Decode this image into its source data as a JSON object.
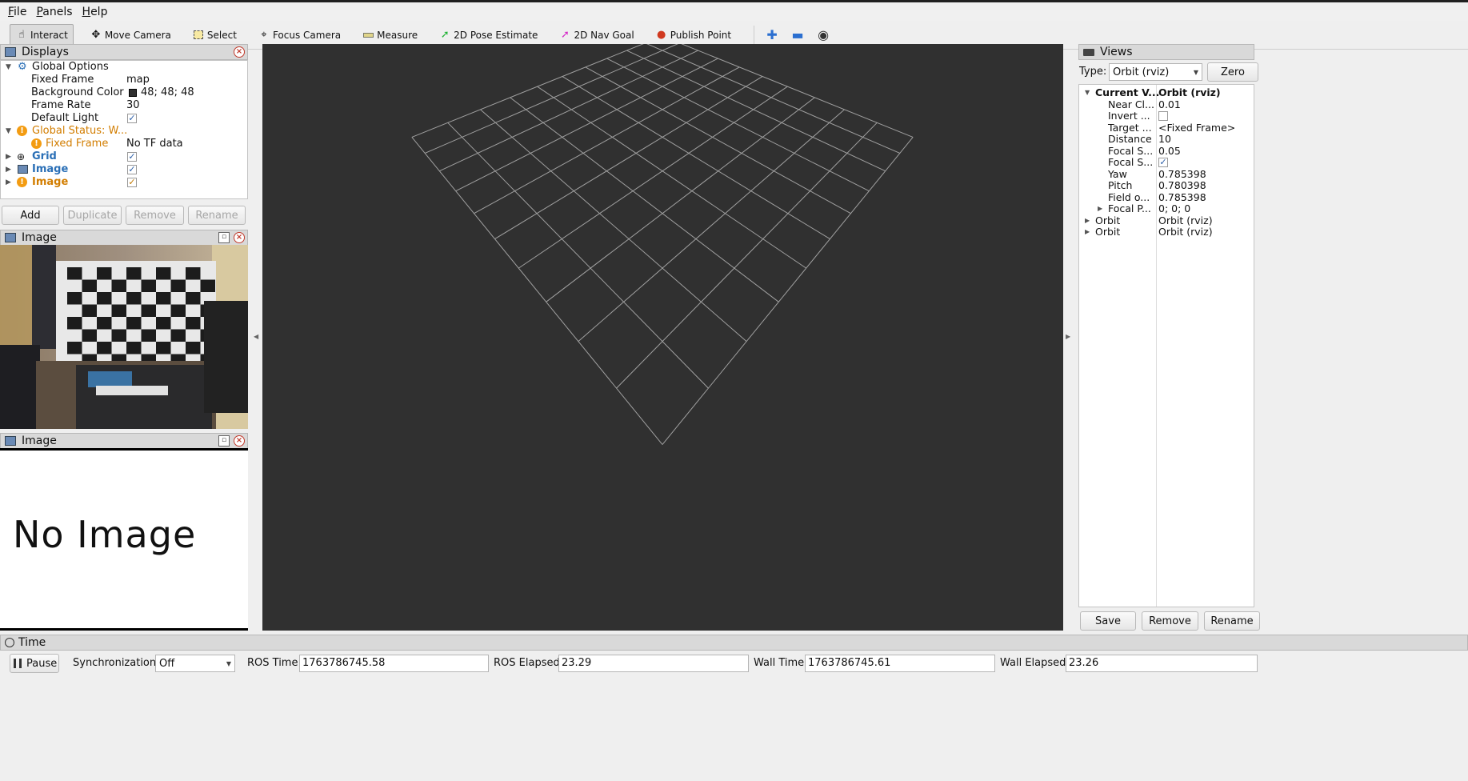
{
  "menu": [
    "File",
    "Panels",
    "Help"
  ],
  "toolbar": {
    "tools": [
      {
        "label": "Interact",
        "icon": "interact-icon"
      },
      {
        "label": "Move Camera",
        "icon": "move-camera-icon"
      },
      {
        "label": "Select",
        "icon": "select-icon"
      },
      {
        "label": "Focus Camera",
        "icon": "focus-camera-icon"
      },
      {
        "label": "Measure",
        "icon": "measure-icon"
      },
      {
        "label": "2D Pose Estimate",
        "icon": "pose-arrow-icon"
      },
      {
        "label": "2D Nav Goal",
        "icon": "nav-goal-arrow-icon"
      },
      {
        "label": "Publish Point",
        "icon": "map-pin-icon"
      }
    ]
  },
  "displays": {
    "title": "Displays",
    "global_options": "Global Options",
    "fixed_frame_label": "Fixed Frame",
    "fixed_frame_value": "map",
    "bg_color_label": "Background Color",
    "bg_color_value": "48; 48; 48",
    "bg_color_swatch": "#303030",
    "frame_rate_label": "Frame Rate",
    "frame_rate_value": "30",
    "default_light_label": "Default Light",
    "global_status": "Global Status: W...",
    "status_fixed_frame": "Fixed Frame",
    "status_fixed_frame_value": "No TF data",
    "grid": "Grid",
    "image1": "Image",
    "image2": "Image",
    "buttons": {
      "add": "Add",
      "duplicate": "Duplicate",
      "remove": "Remove",
      "rename": "Rename"
    }
  },
  "image_panel_1": {
    "title": "Image"
  },
  "image_panel_2": {
    "title": "Image",
    "placeholder": "No Image"
  },
  "views": {
    "title": "Views",
    "type_label": "Type:",
    "type_value": "Orbit (rviz)",
    "zero": "Zero",
    "rows": [
      {
        "name": "Current V...",
        "value": "Orbit (rviz)"
      },
      {
        "name": "Near Cl...",
        "value": "0.01"
      },
      {
        "name": "Invert ...",
        "value": ""
      },
      {
        "name": "Target ...",
        "value": "<Fixed Frame>"
      },
      {
        "name": "Distance",
        "value": "10"
      },
      {
        "name": "Focal S...",
        "value": "0.05"
      },
      {
        "name": "Focal S...",
        "value": ""
      },
      {
        "name": "Yaw",
        "value": "0.785398"
      },
      {
        "name": "Pitch",
        "value": "0.780398"
      },
      {
        "name": "Field o...",
        "value": "0.785398"
      },
      {
        "name": "Focal P...",
        "value": "0; 0; 0"
      },
      {
        "name": "Orbit",
        "value": "Orbit (rviz)"
      },
      {
        "name": "Orbit",
        "value": "Orbit (rviz)"
      }
    ],
    "buttons": {
      "save": "Save",
      "remove": "Remove",
      "rename": "Rename"
    }
  },
  "time": {
    "title": "Time",
    "pause": "Pause",
    "sync_label": "Synchronization:",
    "sync_value": "Off",
    "ros_time_label": "ROS Time:",
    "ros_time": "1763786745.58",
    "ros_elapsed_label": "ROS Elapsed:",
    "ros_elapsed": "23.29",
    "wall_time_label": "Wall Time:",
    "wall_time": "1763786745.61",
    "wall_elapsed_label": "Wall Elapsed:",
    "wall_elapsed": "23.26"
  }
}
